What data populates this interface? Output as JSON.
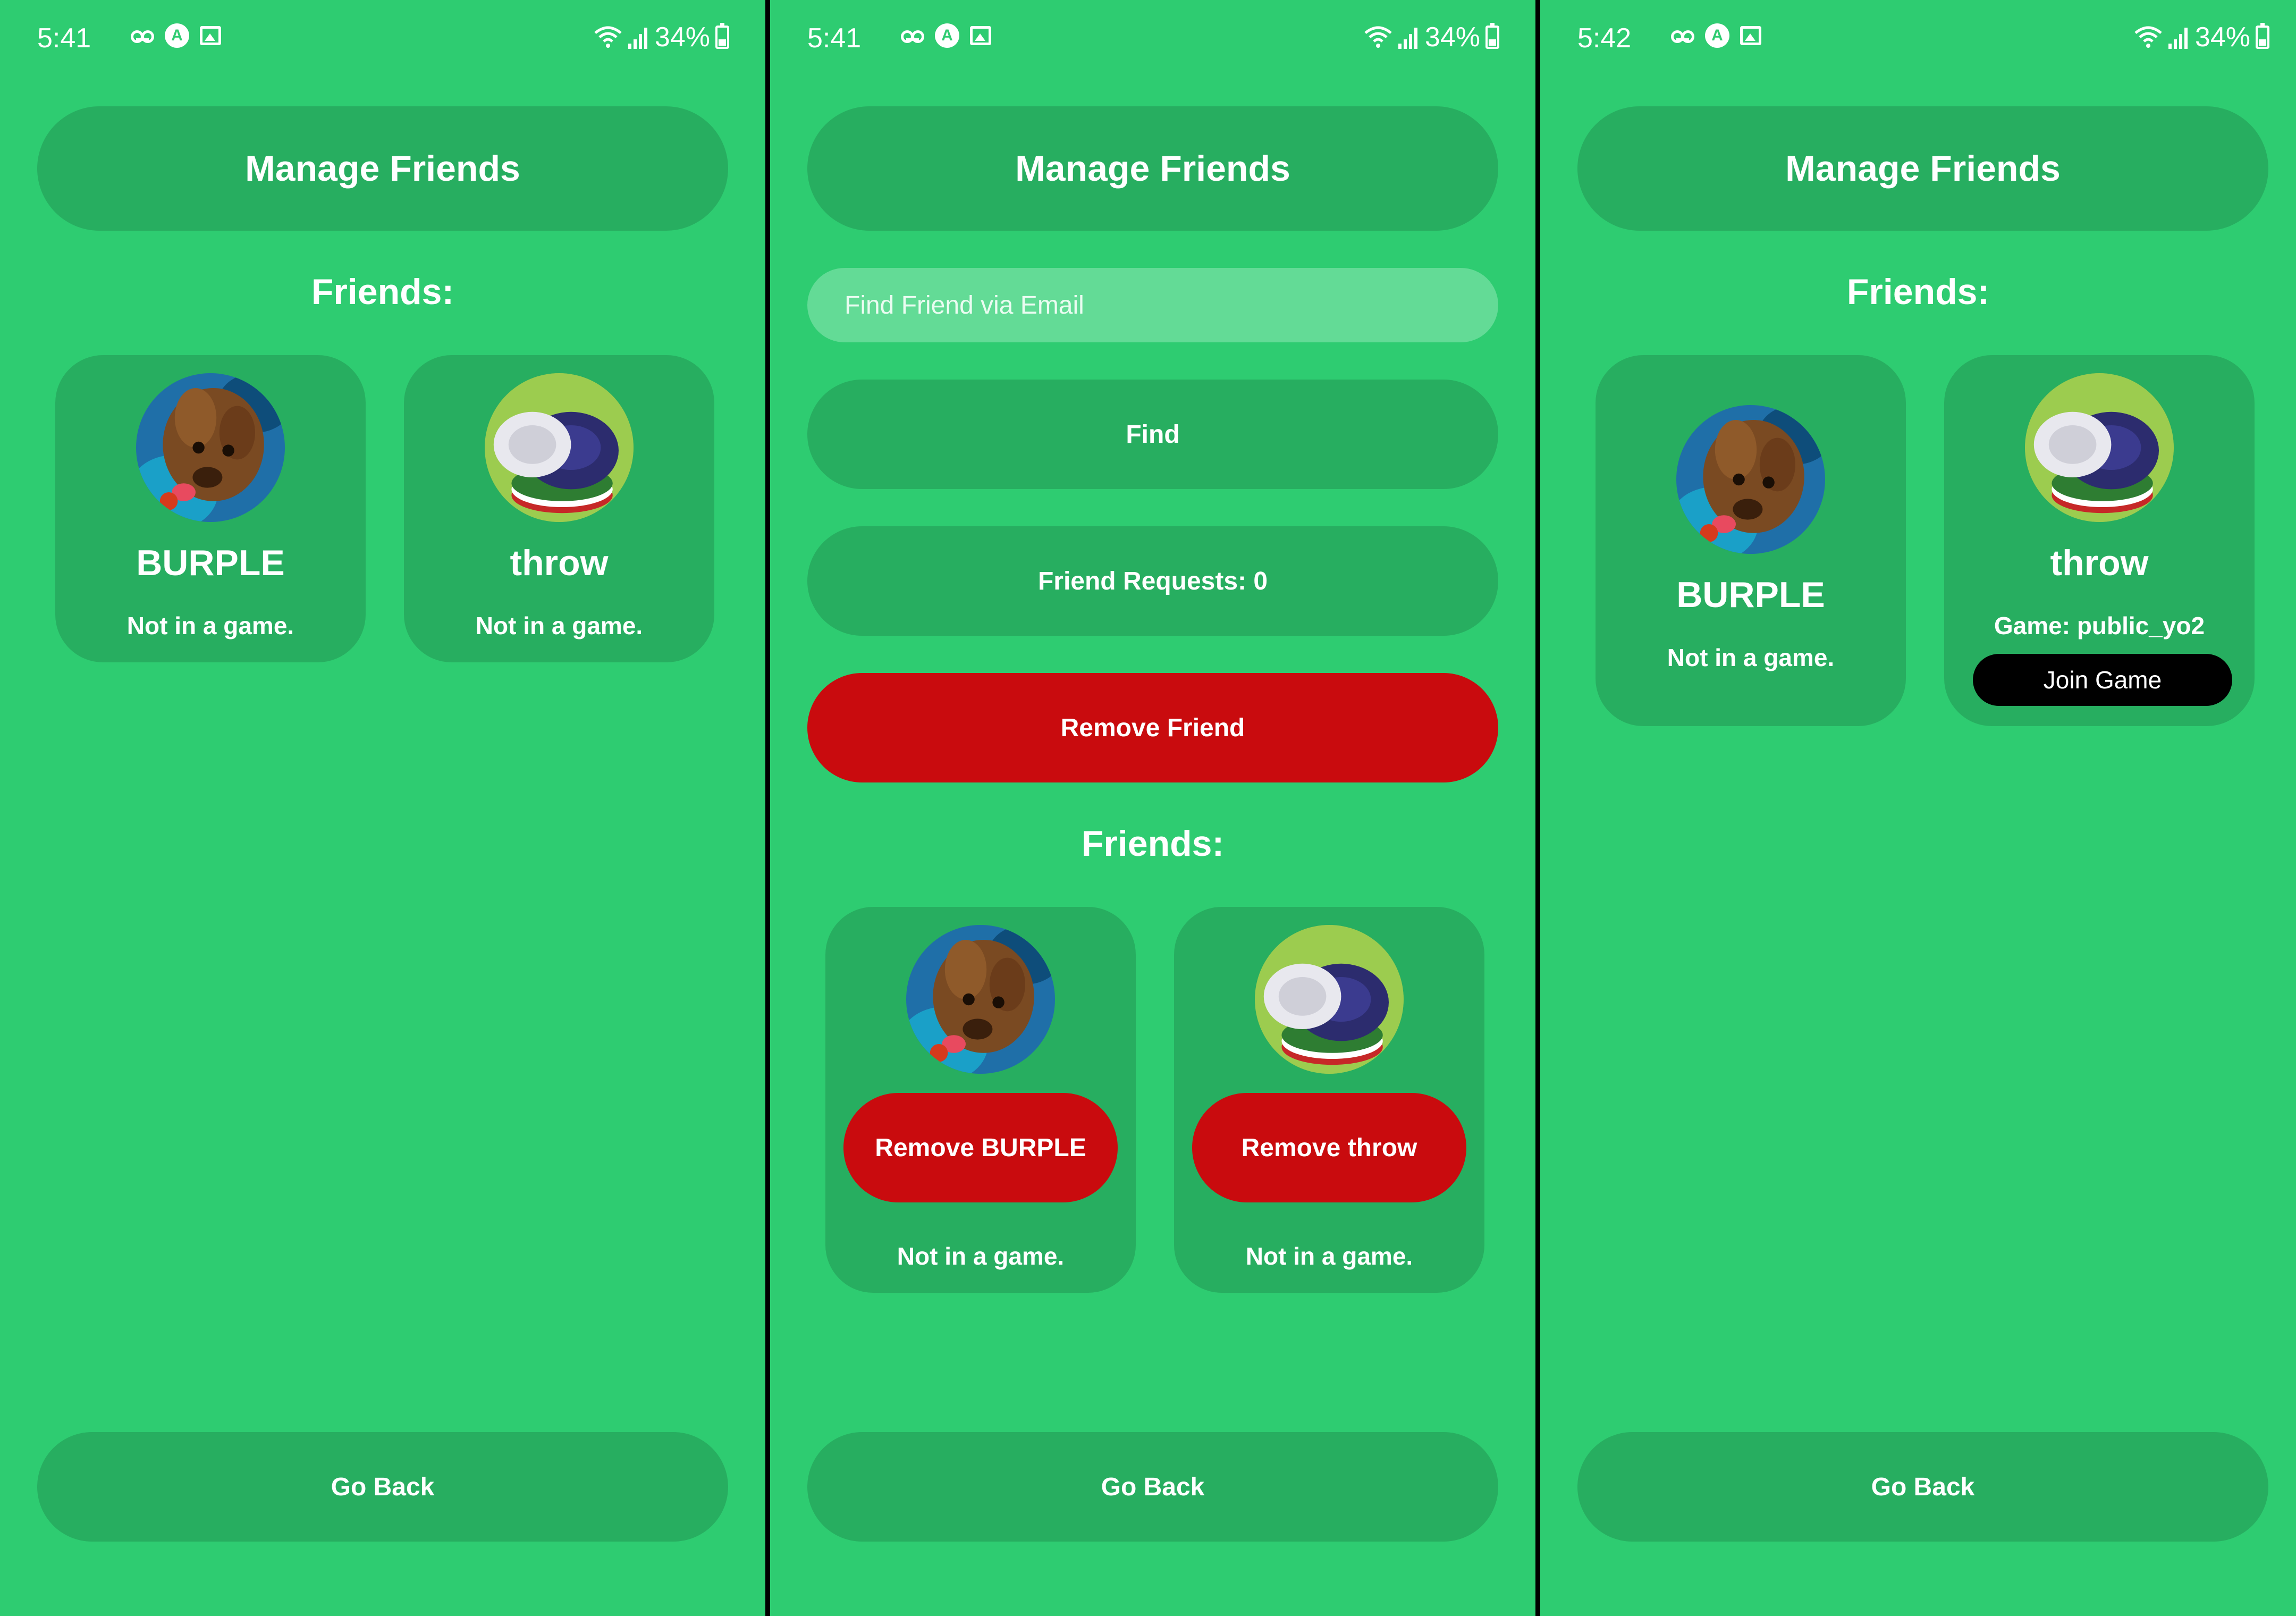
{
  "status_bar": {
    "time_1": "5:41",
    "time_2": "5:41",
    "time_3": "5:42",
    "battery": "34%",
    "app_glyph": "A"
  },
  "common": {
    "title": "Manage Friends",
    "friends_heading": "Friends:",
    "go_back": "Go Back"
  },
  "screen2": {
    "search_placeholder": "Find Friend via Email",
    "find_label": "Find",
    "requests_label": "Friend Requests: 0",
    "remove_friend_label": "Remove Friend"
  },
  "friends": [
    {
      "name": "BURPLE",
      "status": "Not in a game.",
      "remove_label": "Remove BURPLE",
      "avatar": "dog-underwater-avatar"
    },
    {
      "name": "throw",
      "status": "Not in a game.",
      "remove_label": "Remove throw",
      "avatar": "poker-chips-avatar"
    }
  ],
  "screen3": {
    "throw_status": "Game: public_yo2",
    "join_label": "Join Game"
  },
  "colors": {
    "background": "#2ecc71",
    "button": "#27ae60",
    "danger": "#c90b0e",
    "join": "#000000"
  },
  "icons": [
    "voicemail-icon",
    "app-icon",
    "image-icon",
    "wifi-icon",
    "signal-icon",
    "battery-icon"
  ]
}
